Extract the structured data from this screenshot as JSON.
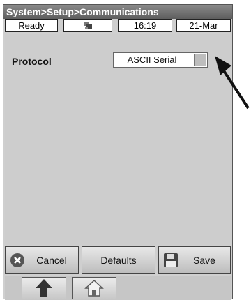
{
  "window": {
    "breadcrumb": "System>Setup>Communications"
  },
  "status": {
    "state": "Ready",
    "icon": "network-icon",
    "time": "16:19",
    "date": "21-Mar"
  },
  "form": {
    "protocol_label": "Protocol",
    "protocol_value": "ASCII Serial"
  },
  "buttons": {
    "cancel": "Cancel",
    "defaults": "Defaults",
    "save": "Save"
  },
  "nav": {
    "up_icon": "up-arrow-icon",
    "home_icon": "home-icon"
  },
  "annotation": {
    "icon": "pointer-arrow-icon"
  },
  "colors": {
    "titlebar": "#6e6e6e",
    "panel": "#cdcdcd",
    "cancel_icon": "#555555"
  }
}
